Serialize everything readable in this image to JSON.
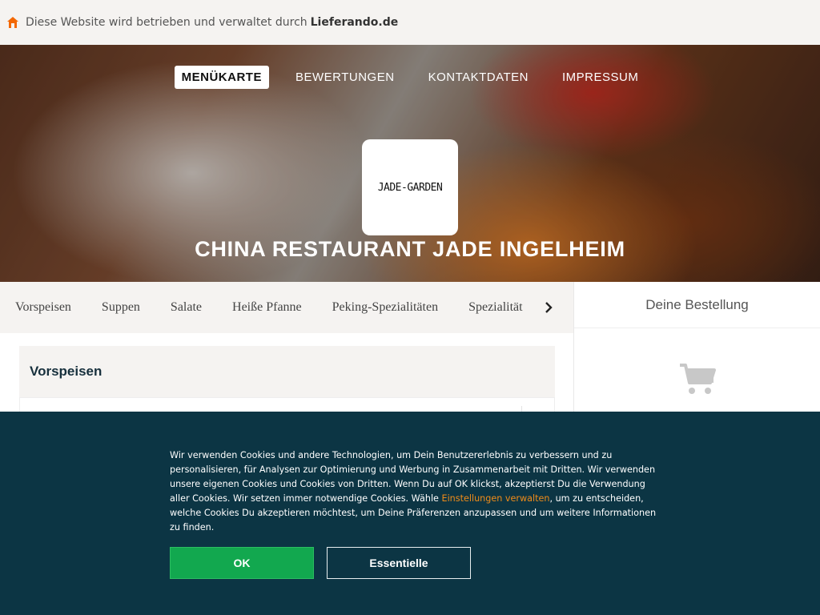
{
  "topbar": {
    "text": "Diese Website wird betrieben und verwaltet durch",
    "brand": "Lieferando.de",
    "icon": "home-icon",
    "icon_color": "#f36805"
  },
  "nav": {
    "items": [
      "MENÜKARTE",
      "BEWERTUNGEN",
      "KONTAKTDATEN",
      "IMPRESSUM"
    ],
    "active_index": 0
  },
  "restaurant": {
    "logo_text": "JADE-GARDEN",
    "name": "CHINA RESTAURANT JADE INGELHEIM"
  },
  "categories": {
    "items": [
      "Vorspeisen",
      "Suppen",
      "Salate",
      "Heiße Pfanne",
      "Peking-Spezialitäten",
      "Spezialitäten"
    ],
    "next_icon": "chevron-right-icon"
  },
  "menu": {
    "section_title": "Vorspeisen"
  },
  "order": {
    "title": "Deine Bestellung",
    "empty_icon": "cart-icon"
  },
  "cookie": {
    "text_before": "Wir verwenden Cookies und andere Technologien, um Dein Benutzererlebnis zu verbessern und zu personalisieren, für Analysen zur Optimierung und Werbung in Zusammenarbeit mit Dritten. Wir verwenden unsere eigenen Cookies und Cookies von Dritten. Wenn Du auf OK klickst, akzeptierst Du die Verwendung aller Cookies. Wir setzen immer notwendige Cookies. Wähle ",
    "link": "Einstellungen verwalten",
    "text_after": ", um zu entscheiden, welche Cookies Du akzeptieren möchtest, um Deine Präferenzen anzupassen und um weitere Informationen zu finden.",
    "ok_label": "OK",
    "essential_label": "Essentielle"
  },
  "colors": {
    "cookie_bg": "#0c3544",
    "ok_green": "#12a84f",
    "link_orange": "#f08c19",
    "heading_dark": "#17303d"
  }
}
